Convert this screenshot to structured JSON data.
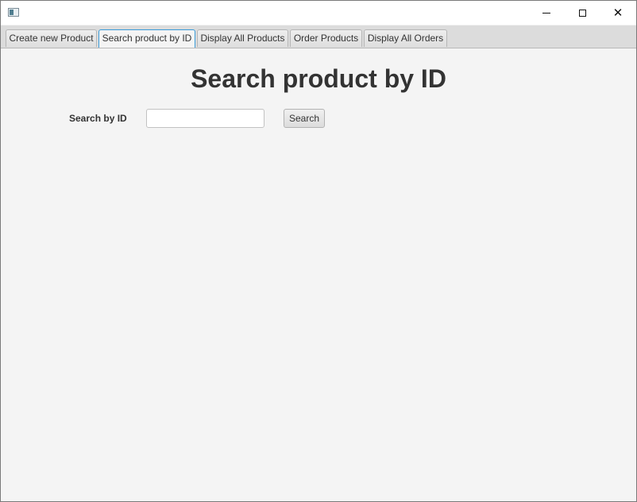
{
  "window": {
    "controls": {
      "minimize_icon": "minimize-icon",
      "maximize_icon": "maximize-icon",
      "close_icon": "close-icon",
      "close_glyph": "✕"
    }
  },
  "tabs": [
    {
      "label": "Create new Product",
      "selected": false
    },
    {
      "label": "Search product by ID",
      "selected": true
    },
    {
      "label": "Display All Products",
      "selected": false
    },
    {
      "label": "Order Products",
      "selected": false
    },
    {
      "label": "Display All Orders",
      "selected": false
    }
  ],
  "main": {
    "title": "Search product by ID",
    "search": {
      "label": "Search by ID",
      "value": "",
      "placeholder": "",
      "button_label": "Search"
    }
  },
  "colors": {
    "accent": "#3a9bd8",
    "background": "#f4f4f4",
    "title_text": "#333333"
  }
}
